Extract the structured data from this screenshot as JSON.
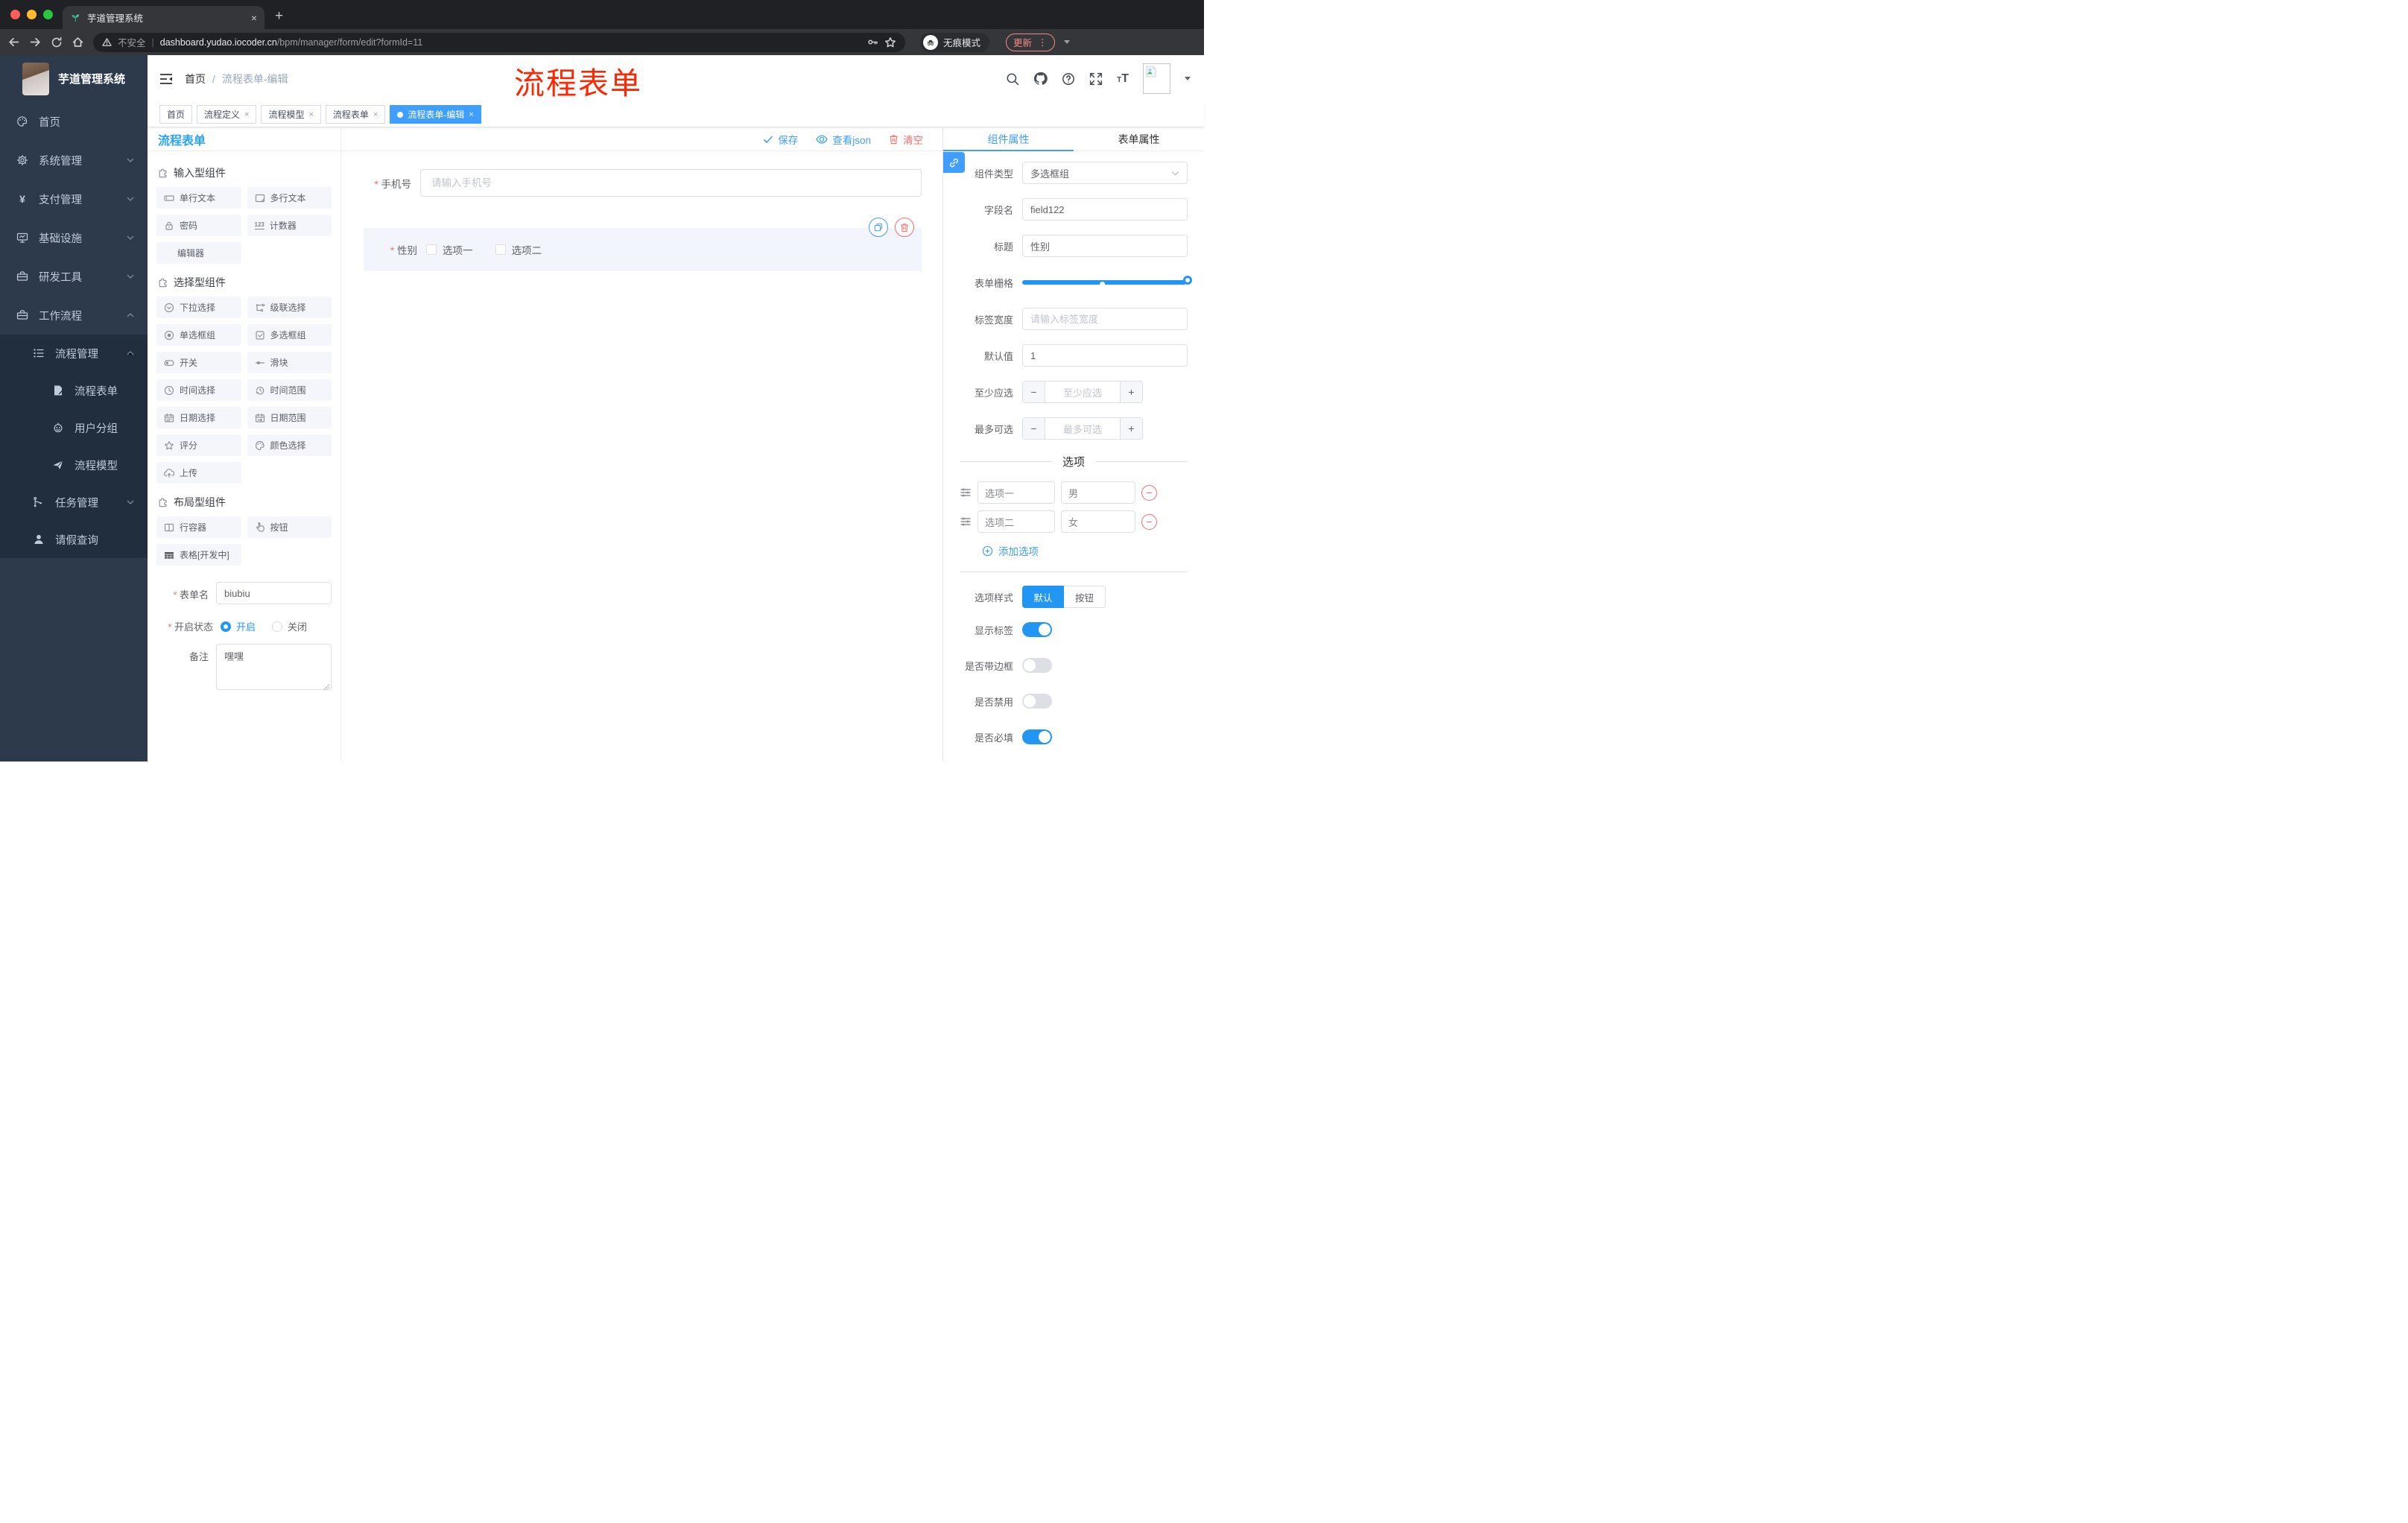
{
  "browser": {
    "tab_title": "芋道管理系统",
    "security_label": "不安全",
    "url_host": "dashboard.yudao.iocoder.cn",
    "url_path": "/bpm/manager/form/edit?formId=11",
    "incognito_label": "无痕模式",
    "update_label": "更新"
  },
  "header": {
    "logo_title": "芋道管理系统",
    "breadcrumb_home": "首页",
    "breadcrumb_sep": "/",
    "breadcrumb_current": "流程表单-编辑",
    "annotation": "流程表单"
  },
  "tags": [
    {
      "label": "首页"
    },
    {
      "label": "流程定义"
    },
    {
      "label": "流程模型"
    },
    {
      "label": "流程表单"
    },
    {
      "label": "流程表单-编辑"
    }
  ],
  "sidebar": {
    "items": [
      {
        "label": "首页"
      },
      {
        "label": "系统管理"
      },
      {
        "label": "支付管理"
      },
      {
        "label": "基础设施"
      },
      {
        "label": "研发工具"
      },
      {
        "label": "工作流程"
      },
      {
        "label": "流程管理"
      },
      {
        "label": "流程表单"
      },
      {
        "label": "用户分组"
      },
      {
        "label": "流程模型"
      },
      {
        "label": "任务管理"
      },
      {
        "label": "请假查询"
      }
    ]
  },
  "palette": {
    "title": "流程表单",
    "groups": [
      {
        "title": "输入型组件",
        "items": [
          "单行文本",
          "多行文本",
          "密码",
          "计数器",
          "编辑器"
        ]
      },
      {
        "title": "选择型组件",
        "items": [
          "下拉选择",
          "级联选择",
          "单选框组",
          "多选框组",
          "开关",
          "滑块",
          "时间选择",
          "时间范围",
          "日期选择",
          "日期范围",
          "评分",
          "颜色选择",
          "上传"
        ]
      },
      {
        "title": "布局型组件",
        "items": [
          "行容器",
          "按钮",
          "表格[开发中]"
        ]
      }
    ],
    "form": {
      "name_label": "表单名",
      "name_value": "biubiu",
      "status_label": "开启状态",
      "status_on": "开启",
      "status_off": "关闭",
      "remark_label": "备注",
      "remark_value": "嘿嘿"
    }
  },
  "canvas": {
    "toolbar": {
      "save": "保存",
      "view_json": "查看json",
      "clear": "清空"
    },
    "phone_field": {
      "label": "手机号",
      "placeholder": "请输入手机号"
    },
    "gender_field": {
      "label": "性别",
      "option1": "选项一",
      "option2": "选项二"
    }
  },
  "props": {
    "tab_component": "组件属性",
    "tab_form": "表单属性",
    "component_type_label": "组件类型",
    "component_type_value": "多选框组",
    "field_name_label": "字段名",
    "field_name_value": "field122",
    "title_label": "标题",
    "title_value": "性别",
    "grid_label": "表单栅格",
    "label_width_label": "标签宽度",
    "label_width_placeholder": "请输入标签宽度",
    "default_label": "默认值",
    "default_value": "1",
    "min_label": "至少应选",
    "min_placeholder": "至少应选",
    "max_label": "最多可选",
    "max_placeholder": "最多可选",
    "options_title": "选项",
    "options": [
      {
        "label": "选项一",
        "value": "男"
      },
      {
        "label": "选项二",
        "value": "女"
      }
    ],
    "add_option": "添加选项",
    "style_label": "选项样式",
    "style_default": "默认",
    "style_button": "按钮",
    "switch_show_label": "显示标签",
    "switch_border": "是否带边框",
    "switch_disabled": "是否禁用",
    "switch_required": "是否必填"
  },
  "glyphs": {
    "minus": "−",
    "plus": "+",
    "close": "×",
    "ellipsis": "⋮",
    "newtab": "+",
    "star": "☆",
    "yen": "¥"
  },
  "colors": {
    "accent": "#409eff",
    "toggle_on": "#2196f3",
    "danger": "#f56c6c",
    "annotation": "#ff2600",
    "sidebar": "#2d3a4b",
    "sidebar_sub": "#212e3e",
    "title_blue": "#2aa3fc"
  }
}
